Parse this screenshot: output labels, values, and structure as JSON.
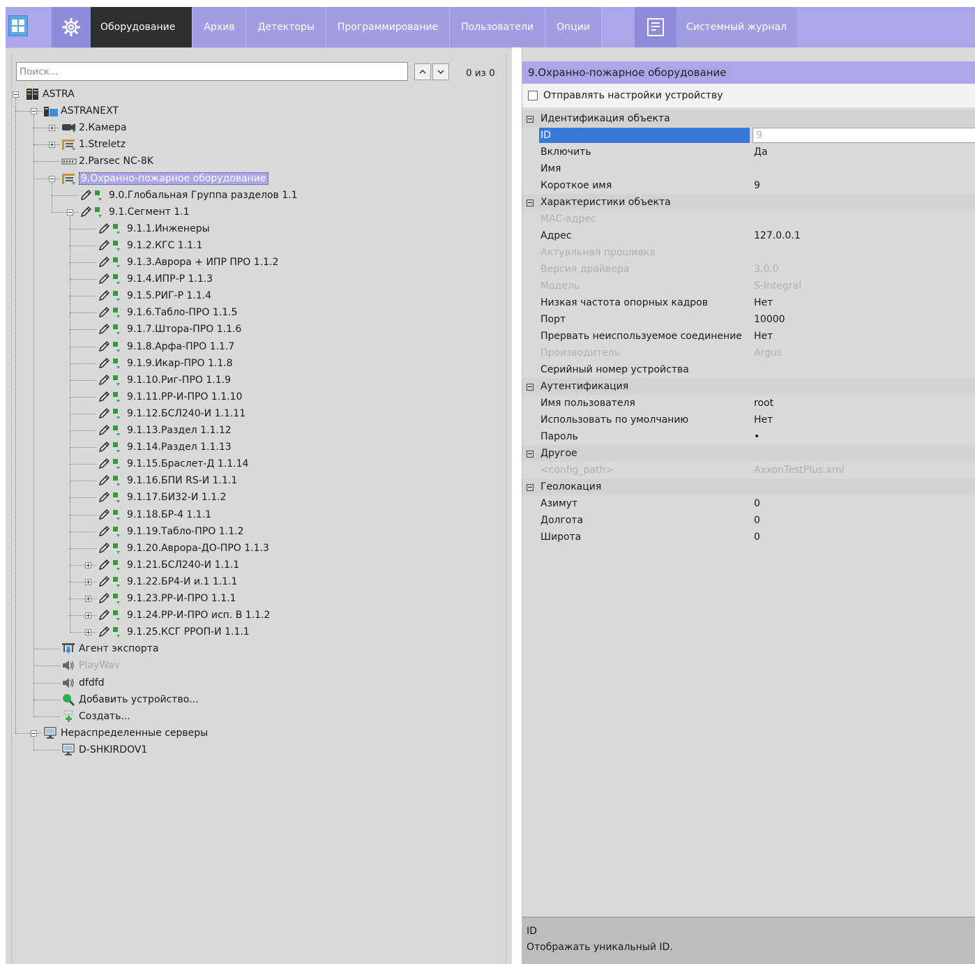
{
  "topbar": {
    "tabs": [
      {
        "label": "Оборудование",
        "active": true
      },
      {
        "label": "Архив"
      },
      {
        "label": "Детекторы"
      },
      {
        "label": "Программирование"
      },
      {
        "label": "Пользователи"
      },
      {
        "label": "Опции"
      }
    ],
    "journal_label": "Системный журнал",
    "icons": [
      "grid-icon",
      "gear-icon",
      "journal-icon"
    ],
    "colors": {
      "bar": "#a9a6ea",
      "active_tab": "#2f2f2f",
      "selection": "#a9a6ea",
      "id_highlight": "#3879d9"
    }
  },
  "search": {
    "placeholder": "Поиск...",
    "value": "",
    "count": "0 из 0"
  },
  "tree": [
    {
      "label": "ASTRA",
      "icon": "server-icon"
    },
    {
      "label": "ASTRANEXT",
      "icon": "server-node-icon"
    },
    {
      "label": "2.Камера",
      "icon": "camera-icon"
    },
    {
      "label": "1.Streletz",
      "icon": "device-icon"
    },
    {
      "label": "2.Parsec NC-8K",
      "icon": "controller-icon"
    },
    {
      "label": "9.Охранно-пожарное оборудование",
      "icon": "device-icon",
      "selected": true
    },
    {
      "label": "9.0.Глобальная Группа разделов 1.1"
    },
    {
      "label": "9.1.Сегмент 1.1"
    },
    {
      "label": "9.1.1.Инженеры"
    },
    {
      "label": "9.1.2.КГС 1.1.1"
    },
    {
      "label": "9.1.3.Аврора + ИПР ПРО 1.1.2"
    },
    {
      "label": "9.1.4.ИПР-Р 1.1.3"
    },
    {
      "label": "9.1.5.РИГ-Р 1.1.4"
    },
    {
      "label": "9.1.6.Табло-ПРО 1.1.5"
    },
    {
      "label": "9.1.7.Штора-ПРО 1.1.6"
    },
    {
      "label": "9.1.8.Арфа-ПРО 1.1.7"
    },
    {
      "label": "9.1.9.Икар-ПРО 1.1.8"
    },
    {
      "label": "9.1.10.Риг-ПРО 1.1.9"
    },
    {
      "label": "9.1.11.РР-И-ПРО 1.1.10"
    },
    {
      "label": "9.1.12.БСЛ240-И 1.1.11"
    },
    {
      "label": "9.1.13.Раздел 1.1.12"
    },
    {
      "label": "9.1.14.Раздел 1.1.13"
    },
    {
      "label": "9.1.15.Браслет-Д 1.1.14"
    },
    {
      "label": "9.1.16.БПИ RS-И 1.1.1"
    },
    {
      "label": "9.1.17.БИ32-И 1.1.2"
    },
    {
      "label": "9.1.18.БР-4 1.1.1"
    },
    {
      "label": "9.1.19.Табло-ПРО 1.1.2"
    },
    {
      "label": "9.1.20.Аврора-ДО-ПРО 1.1.3"
    },
    {
      "label": "9.1.21.БСЛ240-И 1.1.1"
    },
    {
      "label": "9.1.22.БР4-И и.1 1.1.1"
    },
    {
      "label": "9.1.23.РР-И-ПРО 1.1.1"
    },
    {
      "label": "9.1.24.РР-И-ПРО исп. В 1.1.2"
    },
    {
      "label": "9.1.25.КСГ РРОП-И 1.1.1"
    },
    {
      "label": "Агент экспорта",
      "icon": "export-agent-icon"
    },
    {
      "label": "PlayWav",
      "icon": "speaker-icon",
      "disabled": true
    },
    {
      "label": "dfdfd",
      "icon": "speaker-icon"
    },
    {
      "label": "Добавить устройство...",
      "icon": "search-add-icon"
    },
    {
      "label": "Создать...",
      "icon": "create-icon"
    },
    {
      "label": "Нераспределенные серверы",
      "icon": "monitor-icon"
    },
    {
      "label": "D-SHKIRDOV1",
      "icon": "monitor-icon"
    }
  ],
  "properties": {
    "title": "9.Охранно-пожарное оборудование",
    "send_settings_label": "Отправлять настройки устройству",
    "rows": [
      {
        "type": "cat",
        "name": "Идентификация объекта"
      },
      {
        "type": "id",
        "name": "ID",
        "value": "9"
      },
      {
        "name": "Включить",
        "value": "Да"
      },
      {
        "name": "Имя",
        "value": ""
      },
      {
        "name": "Короткое имя",
        "value": "9"
      },
      {
        "type": "cat",
        "name": "Характеристики объекта"
      },
      {
        "name": "MAC-адрес",
        "value": "",
        "disabled": true
      },
      {
        "name": "Адрес",
        "value": "127.0.0.1"
      },
      {
        "name": "Актуальная прошивка",
        "value": "",
        "disabled": true
      },
      {
        "name": "Версия драйвера",
        "value": "3.0.0",
        "disabled": true
      },
      {
        "name": "Модель",
        "value": "S-Integral",
        "disabled": true
      },
      {
        "name": "Низкая частота опорных кадров",
        "value": "Нет"
      },
      {
        "name": "Порт",
        "value": "10000"
      },
      {
        "name": "Прервать неиспользуемое соединение",
        "value": "Нет"
      },
      {
        "name": "Производитель",
        "value": "Argus",
        "disabled": true
      },
      {
        "name": "Серийный номер устройства",
        "value": ""
      },
      {
        "type": "cat",
        "name": "Аутентификация"
      },
      {
        "name": "Имя пользователя",
        "value": "root"
      },
      {
        "name": "Использовать по умолчанию",
        "value": "Нет"
      },
      {
        "name": "Пароль",
        "value": "•"
      },
      {
        "type": "cat",
        "name": "Другое"
      },
      {
        "name": "<config_path>",
        "value": "AxxonTestPlus.xml",
        "disabled": true
      },
      {
        "type": "cat",
        "name": "Геолокация"
      },
      {
        "name": "Азимут",
        "value": "0"
      },
      {
        "name": "Долгота",
        "value": "0"
      },
      {
        "name": "Широта",
        "value": "0"
      }
    ],
    "description_title": "ID",
    "description_text": "Отображать уникальный ID."
  }
}
